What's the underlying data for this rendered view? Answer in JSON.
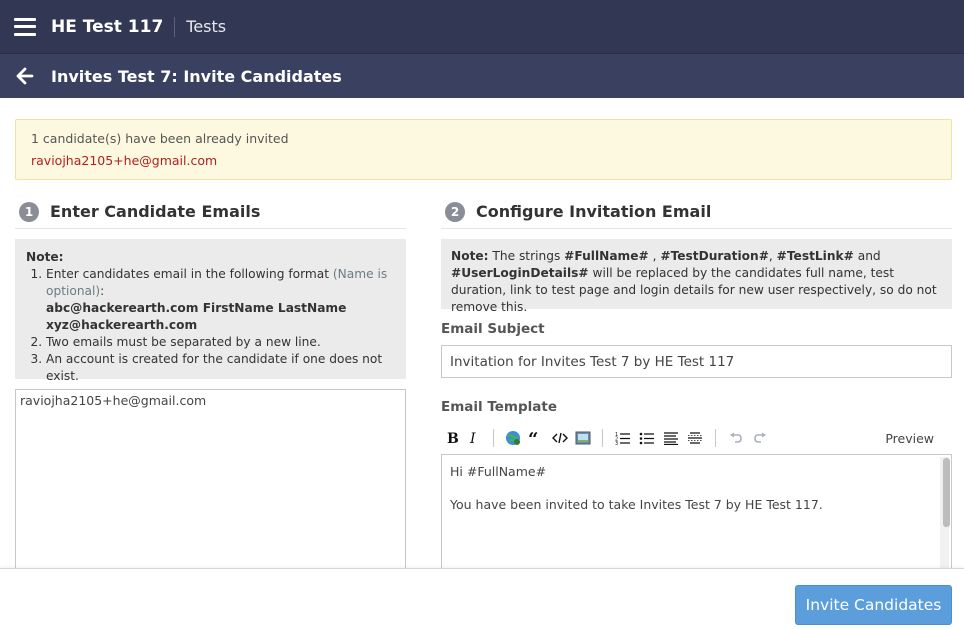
{
  "header": {
    "app_title": "HE Test 117",
    "section": "Tests"
  },
  "subheader": {
    "page_title": "Invites Test 7: Invite Candidates"
  },
  "alert": {
    "message": "1 candidate(s) have been already invited",
    "emails": [
      "raviojha2105+he@gmail.com"
    ],
    "email_color": "#b02020"
  },
  "left": {
    "step": "1",
    "title": "Enter Candidate Emails",
    "note_label": "Note:",
    "note_items": {
      "item1_text": "Enter candidates email in the following format ",
      "item1_hint": "(Name is optional)",
      "item1_colon": ":",
      "format_line1": "abc@hackerearth.com FirstName LastName",
      "format_line2": "xyz@hackerearth.com",
      "item2": "Two emails must be separated by a new line.",
      "item3": "An account is created for the candidate if one does not exist."
    },
    "emails_value": "raviojha2105+he@gmail.com"
  },
  "right": {
    "step": "2",
    "title": "Configure Invitation Email",
    "note": {
      "label": "Note:",
      "t1": " The strings ",
      "k1": "#FullName#",
      "t2": " , ",
      "k2": "#TestDuration#",
      "t3": ", ",
      "k3": "#TestLink#",
      "t4": " and ",
      "k4": "#UserLoginDetails#",
      "t5": " will be replaced by the candidates full name, test duration, link to test page and login details for new user respectively, so do not remove this."
    },
    "subject_label": "Email Subject",
    "subject_value": "Invitation for Invites Test 7 by HE Test 117",
    "template_label": "Email Template",
    "toolbar": {
      "icons": [
        "bold-icon",
        "italic-icon",
        "link-icon",
        "quote-icon",
        "code-icon",
        "image-icon",
        "ordered-list-icon",
        "unordered-list-icon",
        "align-icon",
        "horizontal-rule-icon",
        "undo-icon",
        "redo-icon"
      ],
      "preview_label": "Preview"
    },
    "template_lines": {
      "line1": "Hi #FullName#",
      "line2": "You have been invited to take Invites Test 7 by HE Test 117."
    }
  },
  "footer": {
    "invite_button": "Invite Candidates",
    "button_color": "#5b9edb"
  }
}
